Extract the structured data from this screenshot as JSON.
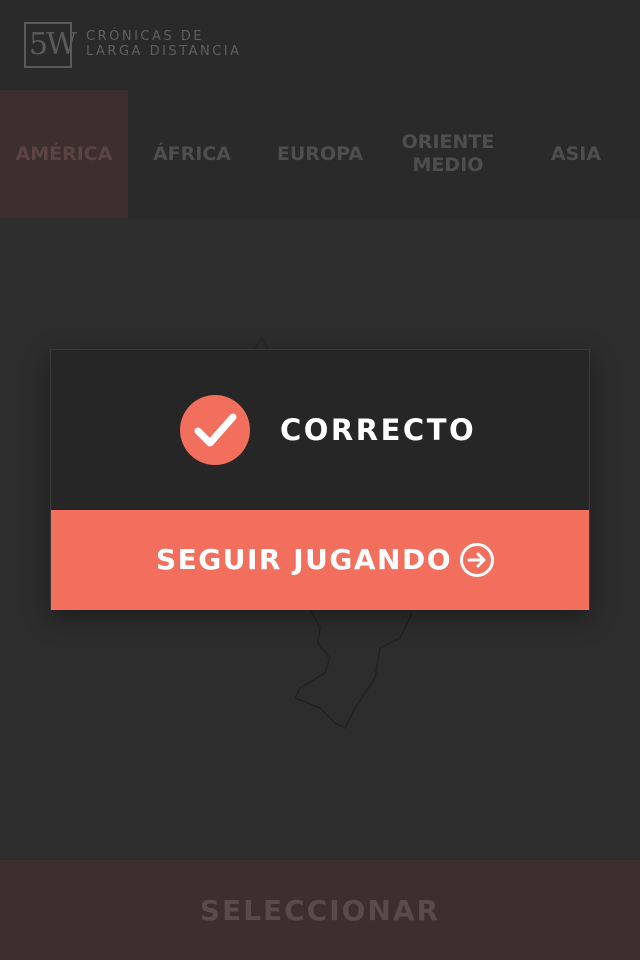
{
  "header": {
    "logo_mark": "5W",
    "logo_line1": "CRÓNICAS DE",
    "logo_line2": "LARGA DISTANCIA"
  },
  "tabs": [
    {
      "label": "AMÉRICA",
      "active": true
    },
    {
      "label": "ÁFRICA",
      "active": false
    },
    {
      "label": "EUROPA",
      "active": false
    },
    {
      "label": "ORIENTE\nMEDIO",
      "active": false
    },
    {
      "label": "ASIA",
      "active": false
    }
  ],
  "modal": {
    "icon": "check-icon",
    "title": "CORRECTO",
    "button_label": "SEGUIR JUGANDO",
    "button_icon": "arrow-right-circle-icon"
  },
  "footer": {
    "select_label": "SELECCIONAR"
  },
  "colors": {
    "accent": "#f26e5d",
    "background": "#2d2d2d",
    "active_tab": "#3d2f2d"
  }
}
